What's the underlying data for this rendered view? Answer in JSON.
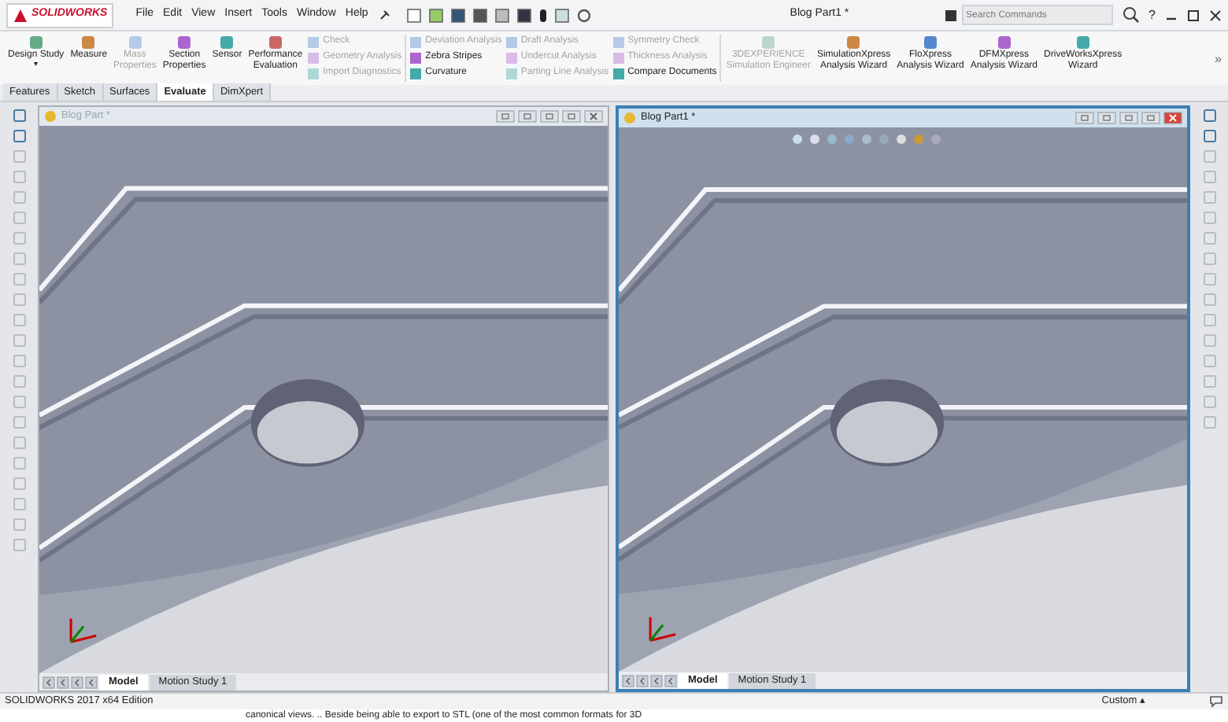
{
  "title_bar": {
    "logo": "SOLIDWORKS",
    "menus": [
      "File",
      "Edit",
      "View",
      "Insert",
      "Tools",
      "Window",
      "Help"
    ],
    "document_title": "Blog Part1 *",
    "search": {
      "placeholder": "Search Commands"
    },
    "help": "?"
  },
  "ribbon": {
    "sections": [
      [
        {
          "kind": "large",
          "items": [
            {
              "label": "Design Study",
              "disabled": false,
              "dropdown": "▾"
            },
            {
              "label": "Measure",
              "disabled": false
            },
            {
              "label": "Mass\nProperties",
              "disabled": true
            },
            {
              "label": "Section\nProperties",
              "disabled": false
            },
            {
              "label": "Sensor",
              "disabled": false
            },
            {
              "label": "Performance\nEvaluation",
              "disabled": false
            }
          ]
        },
        {
          "kind": "small",
          "items": [
            {
              "label": "Check",
              "disabled": true
            },
            {
              "label": "Geometry Analysis",
              "disabled": true
            },
            {
              "label": "Import Diagnostics",
              "disabled": true
            }
          ]
        }
      ],
      [
        {
          "kind": "small",
          "items": [
            {
              "label": "Deviation Analysis",
              "disabled": true
            },
            {
              "label": "Zebra Stripes",
              "disabled": false
            },
            {
              "label": "Curvature",
              "disabled": false
            }
          ]
        },
        {
          "kind": "small",
          "items": [
            {
              "label": "Draft Analysis",
              "disabled": true
            },
            {
              "label": "Undercut Analysis",
              "disabled": true
            },
            {
              "label": "Parting Line Analysis",
              "disabled": true
            }
          ]
        },
        {
          "kind": "small",
          "items": [
            {
              "label": "Symmetry Check",
              "disabled": true
            },
            {
              "label": "Thickness Analysis",
              "disabled": true
            },
            {
              "label": "Compare Documents",
              "disabled": false
            }
          ]
        }
      ],
      [
        {
          "kind": "large",
          "items": [
            {
              "label": "3DEXPERIENCE\nSimulation Engineer",
              "disabled": true
            },
            {
              "label": "SimulationXpress\nAnalysis Wizard",
              "disabled": false
            },
            {
              "label": "FloXpress\nAnalysis Wizard",
              "disabled": false
            },
            {
              "label": "DFMXpress\nAnalysis Wizard",
              "disabled": false
            },
            {
              "label": "DriveWorksXpress\nWizard",
              "disabled": false
            }
          ]
        }
      ]
    ],
    "more": "»"
  },
  "tabs": [
    {
      "label": "Features",
      "selected": false
    },
    {
      "label": "Sketch",
      "selected": false
    },
    {
      "label": "Surfaces",
      "selected": false
    },
    {
      "label": "Evaluate",
      "selected": true
    },
    {
      "label": "DimXpert",
      "selected": false
    }
  ],
  "viewports": [
    {
      "title": "Blog Part *",
      "active": false,
      "tabs": [
        {
          "label": "Model",
          "selected": true
        },
        {
          "label": "Motion Study 1",
          "selected": false
        }
      ]
    },
    {
      "title": "Blog Part1 *",
      "active": true,
      "tabs": [
        {
          "label": "Model",
          "selected": true
        },
        {
          "label": "Motion Study 1",
          "selected": false
        }
      ]
    }
  ],
  "status_bar": {
    "edition": "SOLIDWORKS 2017 x64 Edition",
    "units": "Custom",
    "units_caret": "▴"
  },
  "footer_text": "canonical views. .. Beside being able to export to STL (one of the most common formats for 3D"
}
